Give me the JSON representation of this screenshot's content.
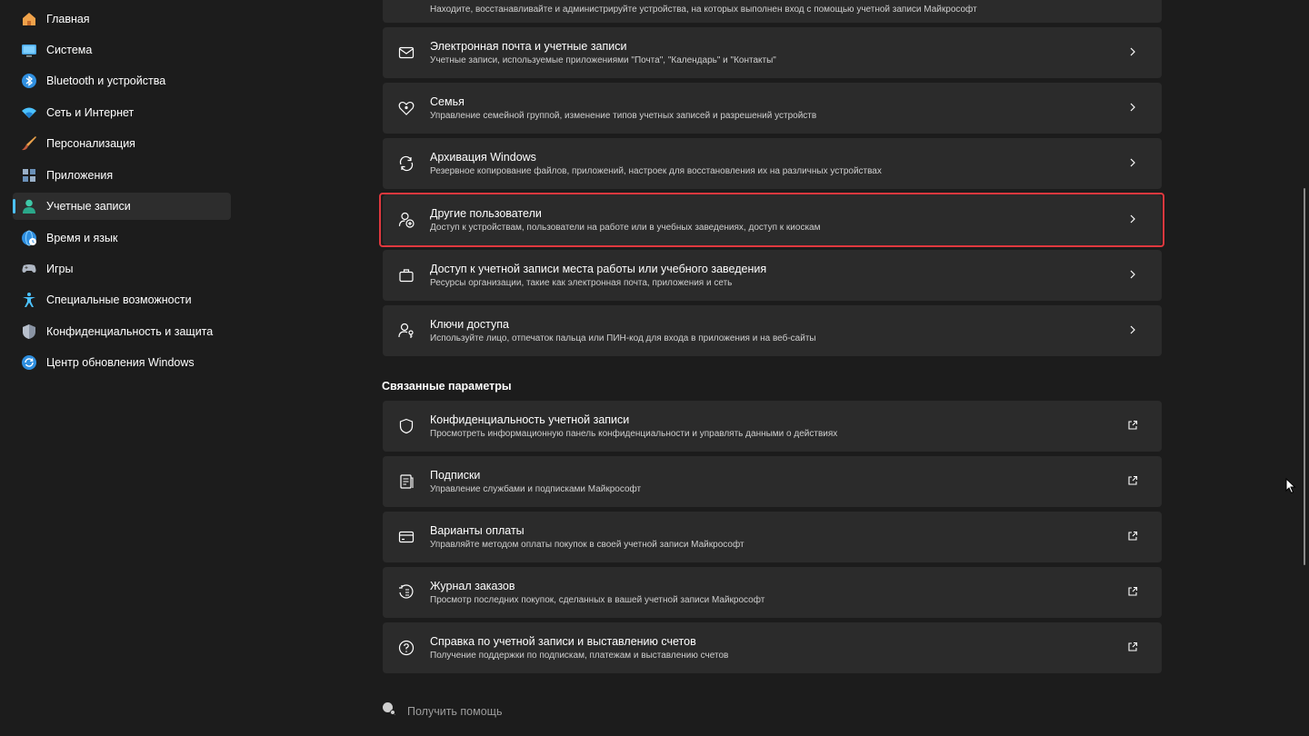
{
  "sidebar": {
    "items": [
      {
        "label": "Главная",
        "icon": "home-icon"
      },
      {
        "label": "Система",
        "icon": "monitor-icon"
      },
      {
        "label": "Bluetooth и устройства",
        "icon": "bluetooth-icon"
      },
      {
        "label": "Сеть и Интернет",
        "icon": "wifi-icon"
      },
      {
        "label": "Персонализация",
        "icon": "brush-icon"
      },
      {
        "label": "Приложения",
        "icon": "apps-icon"
      },
      {
        "label": "Учетные записи",
        "icon": "user-icon",
        "active": true
      },
      {
        "label": "Время и язык",
        "icon": "globe-clock-icon"
      },
      {
        "label": "Игры",
        "icon": "gamepad-icon"
      },
      {
        "label": "Специальные возможности",
        "icon": "accessibility-icon"
      },
      {
        "label": "Конфиденциальность и защита",
        "icon": "shield-icon"
      },
      {
        "label": "Центр обновления Windows",
        "icon": "update-icon"
      }
    ]
  },
  "cards": [
    {
      "title": "",
      "subtitle": "Находите, восстанавливайте и администрируйте устройства, на которых выполнен вход с помощью учетной записи Майкрософт",
      "icon": "",
      "action": "chevron"
    },
    {
      "title": "Электронная почта и учетные записи",
      "subtitle": "Учетные записи, используемые приложениями \"Почта\", \"Календарь\" и \"Контакты\"",
      "icon": "mail-icon",
      "action": "chevron"
    },
    {
      "title": "Семья",
      "subtitle": "Управление семейной группой, изменение типов учетных записей и разрешений устройств",
      "icon": "family-heart-icon",
      "action": "chevron"
    },
    {
      "title": "Архивация Windows",
      "subtitle": "Резервное копирование файлов, приложений, настроек для восстановления их на различных устройствах",
      "icon": "backup-icon",
      "action": "chevron"
    },
    {
      "title": "Другие пользователи",
      "subtitle": "Доступ к устройствам, пользователи на работе или в учебных заведениях, доступ к киоскам",
      "icon": "add-user-icon",
      "action": "chevron",
      "highlighted": true
    },
    {
      "title": "Доступ к учетной записи места работы или учебного заведения",
      "subtitle": "Ресурсы организации, такие как электронная почта, приложения и сеть",
      "icon": "briefcase-icon",
      "action": "chevron"
    },
    {
      "title": "Ключи доступа",
      "subtitle": "Используйте лицо, отпечаток пальца или ПИН-код для входа в приложения и на веб-сайты",
      "icon": "passkey-icon",
      "action": "chevron"
    }
  ],
  "related": {
    "title": "Связанные параметры",
    "cards": [
      {
        "title": "Конфиденциальность учетной записи",
        "subtitle": "Просмотреть информационную панель конфиденциальности и управлять данными о действиях",
        "icon": "shield-outline-icon",
        "action": "external"
      },
      {
        "title": "Подписки",
        "subtitle": "Управление службами и подписками Майкрософт",
        "icon": "subscriptions-icon",
        "action": "external"
      },
      {
        "title": "Варианты оплаты",
        "subtitle": "Управляйте методом оплаты покупок в своей учетной записи Майкрософт",
        "icon": "credit-card-icon",
        "action": "external"
      },
      {
        "title": "Журнал заказов",
        "subtitle": "Просмотр последних покупок, сделанных в вашей учетной записи Майкрософт",
        "icon": "history-icon",
        "action": "external"
      },
      {
        "title": "Справка по учетной записи и выставлению счетов",
        "subtitle": "Получение поддержки по подпискам, платежам и выставлению счетов",
        "icon": "help-icon",
        "action": "external"
      }
    ]
  },
  "help": {
    "label": "Получить помощь",
    "icon": "help-chat-icon"
  },
  "colors": {
    "accent": "#4cc2ff",
    "highlight": "#e0383e",
    "card": "#2b2b2b",
    "background": "#1c1c1c"
  }
}
